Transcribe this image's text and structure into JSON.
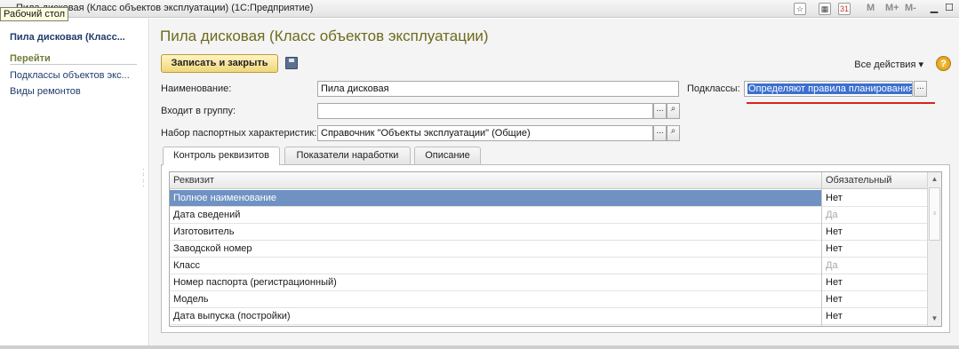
{
  "window": {
    "title": "Пила дисковая (Класс объектов эксплуатации)  (1С:Предприятие)",
    "tooltip": "Рабочий стол",
    "toolbar_m": [
      "M",
      "M+",
      "M-"
    ],
    "calendar_day": "31"
  },
  "leftnav": {
    "current": "Пила дисковая (Класс...",
    "section": "Перейти",
    "links": [
      "Подклассы объектов экс...",
      "Виды ремонтов"
    ]
  },
  "form": {
    "title": "Пила дисковая (Класс объектов эксплуатации)",
    "save_close_label": "Записать и закрыть",
    "all_actions_label": "Все действия ▾",
    "help_label": "?",
    "name_label": "Наименование:",
    "name_value": "Пила дисковая",
    "subclasses_label": "Подклассы:",
    "subclasses_value": "Определяют правила планирования",
    "group_label": "Входит в группу:",
    "group_value": "",
    "passport_label": "Набор паспортных характеристик:",
    "passport_value": "Справочник \"Объекты эксплуатации\" (Общие)",
    "select_btn": "...",
    "search_btn": "🔍"
  },
  "tabs": [
    {
      "label": "Контроль реквизитов"
    },
    {
      "label": "Показатели наработки"
    },
    {
      "label": "Описание"
    }
  ],
  "table": {
    "headers": [
      "Реквизит",
      "Обязательный"
    ],
    "rows": [
      {
        "name": "Полное наименование",
        "required": "Нет",
        "muted": false
      },
      {
        "name": "Дата сведений",
        "required": "Да",
        "muted": true
      },
      {
        "name": "Изготовитель",
        "required": "Нет",
        "muted": false
      },
      {
        "name": "Заводской номер",
        "required": "Нет",
        "muted": false
      },
      {
        "name": "Класс",
        "required": "Да",
        "muted": true
      },
      {
        "name": "Номер паспорта (регистрационный)",
        "required": "Нет",
        "muted": false
      },
      {
        "name": "Модель",
        "required": "Нет",
        "muted": false
      },
      {
        "name": "Дата выпуска (постройки)",
        "required": "Нет",
        "muted": false
      }
    ]
  }
}
